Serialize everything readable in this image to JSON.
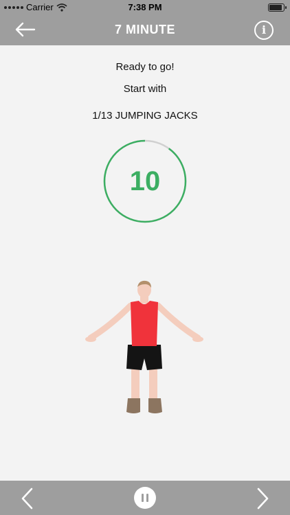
{
  "status_bar": {
    "carrier": "Carrier",
    "time": "7:38 PM"
  },
  "nav": {
    "title": "7 MINUTE",
    "back_icon": "arrow-left-icon",
    "info_icon": "info-icon",
    "info_glyph": "i"
  },
  "main": {
    "ready_text": "Ready to go!",
    "start_text": "Start with",
    "exercise_text": "1/13 JUMPING JACKS",
    "countdown": "10",
    "countdown_progress_remaining": 0.9
  },
  "controls": {
    "previous_icon": "chevron-left-icon",
    "pause_icon": "pause-icon",
    "next_icon": "chevron-right-icon"
  },
  "colors": {
    "bar_background": "#9e9e9e",
    "page_background": "#f3f3f3",
    "accent_green": "#3cae62",
    "ring_track": "#d0d0d0"
  }
}
